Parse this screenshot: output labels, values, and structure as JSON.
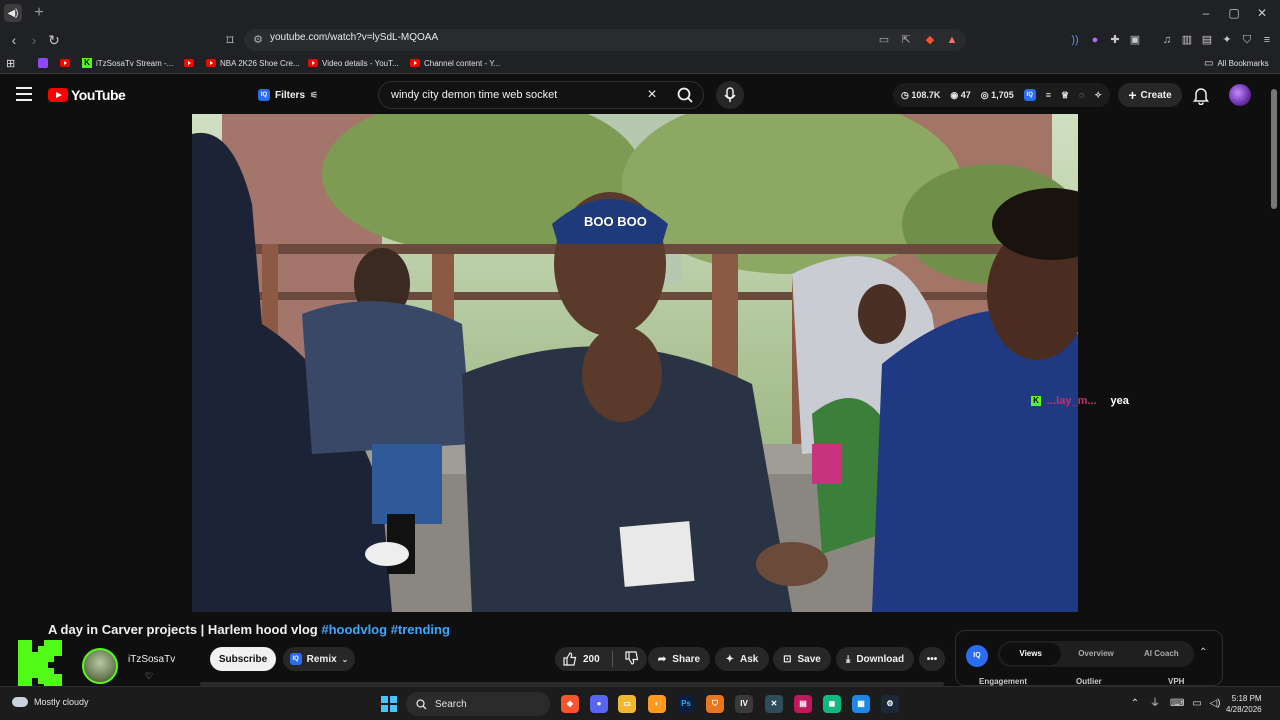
{
  "browser": {
    "url": "youtube.com/watch?v=lySdL-MQOAA",
    "bookmarks": [
      {
        "label": "iTzSosaTv Stream -...",
        "icon": "kick-icon"
      },
      {
        "label": "NBA 2K26 Shoe Cre...",
        "icon": "youtube-icon"
      },
      {
        "label": "Video details - YouT...",
        "icon": "youtube-icon"
      },
      {
        "label": "Channel content - Y...",
        "icon": "youtube-icon"
      }
    ],
    "all_bookmarks": "All Bookmarks",
    "window_controls": {
      "minimize": "–",
      "maximize": "▢",
      "close": "✕"
    }
  },
  "youtube": {
    "logo_text": "YouTube",
    "filters_label": "Filters",
    "search_query": "windy city demon time web socket",
    "stats": {
      "views": "108.7K",
      "watching": "47",
      "third": "1,705"
    },
    "create_label": "Create"
  },
  "video": {
    "title_text": "A day in Carver projects | Harlem hood vlog ",
    "hashtags": [
      "#hoodvlog",
      "#trending"
    ],
    "chat_overlay": {
      "user": "...lay_m...",
      "message": "yea"
    },
    "hat_text": "BOO BOO"
  },
  "channel": {
    "name": "iTzSosaTv",
    "subscribe_label": "Subscribe",
    "remix_label": "Remix"
  },
  "actions": {
    "like_count": "200",
    "share_label": "Share",
    "ask_label": "Ask",
    "save_label": "Save",
    "download_label": "Download"
  },
  "iq_panel": {
    "badge": "IQ",
    "tabs": [
      "Views",
      "Overview",
      "AI Coach"
    ],
    "active_tab": "Views",
    "columns": [
      "Engagement",
      "Outlier",
      "VPH"
    ]
  },
  "taskbar": {
    "weather": "Mostly cloudy",
    "search_label": "Search",
    "time": "5:18 PM",
    "date": "4/28/2026"
  },
  "colors": {
    "yt_red": "#ff0000",
    "kick_green": "#53fc18",
    "link_blue": "#3ea6ff",
    "iq_blue": "#2a6df4"
  }
}
